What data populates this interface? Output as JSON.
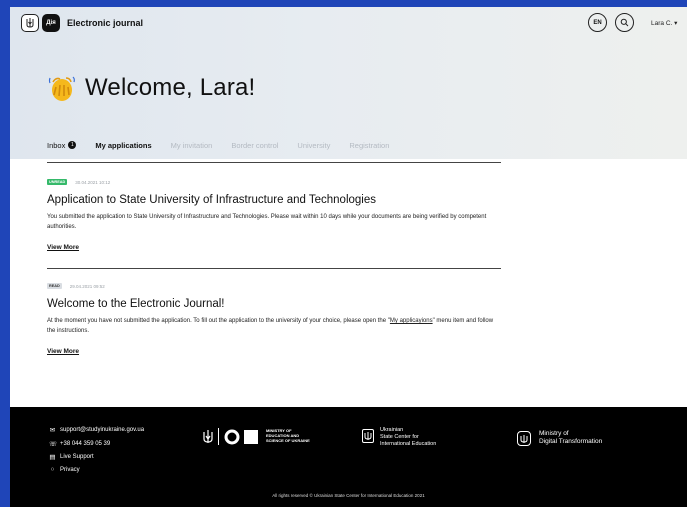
{
  "header": {
    "app_title": "Electronic journal",
    "diia_logo": "Дія",
    "language": "EN",
    "search_icon": "search-icon",
    "user_name": "Lara C. ▾"
  },
  "welcome": {
    "emoji": "waving-hand",
    "title": "Welcome, Lara!"
  },
  "tabs": [
    {
      "label": "Inbox",
      "badge": "1",
      "state": "active"
    },
    {
      "label": "My applications",
      "state": "bold"
    },
    {
      "label": "My invitation",
      "state": "disabled"
    },
    {
      "label": "Border control",
      "state": "disabled"
    },
    {
      "label": "University",
      "state": "disabled"
    },
    {
      "label": "Registration",
      "state": "disabled"
    }
  ],
  "messages": [
    {
      "status": "UNREAD",
      "date": "30.04.2021 10:12",
      "title": "Application to State University of Infrastructure and Technologies",
      "body": "You submitted the application to State University of Infrastructure and Technologies. Please wait within 10 days while your documents are being verified by competent authorities.",
      "link": "View More"
    },
    {
      "status": "READ",
      "date": "29.04.2021 09:52",
      "title": "Welcome to the Electronic Journal!",
      "body_before": "At the moment  you have not submitted the application. To fill out the application to the university of your choice, please open the \"",
      "body_link": "My applicayions",
      "body_after": "\" menu item and follow the instructions.",
      "link": "View More"
    }
  ],
  "footer": {
    "email": "support@studyinukraine.gov.ua",
    "phone": "+38 044 359 05 39",
    "live_support": "Live Support",
    "privacy": "Privacy",
    "mon_line1": "MINISTRY OF",
    "mon_line2": "EDUCATION AND",
    "mon_line3": "SCIENCE OF UKRAINE",
    "center_line1": "Ukrainian",
    "center_line2": "State Center for",
    "center_line3": "International Education",
    "digital_line1": "Ministry of",
    "digital_line2": "Digital Transformation",
    "rights": "All rights reserved © Ukrainian State Center for International Education 2021"
  }
}
